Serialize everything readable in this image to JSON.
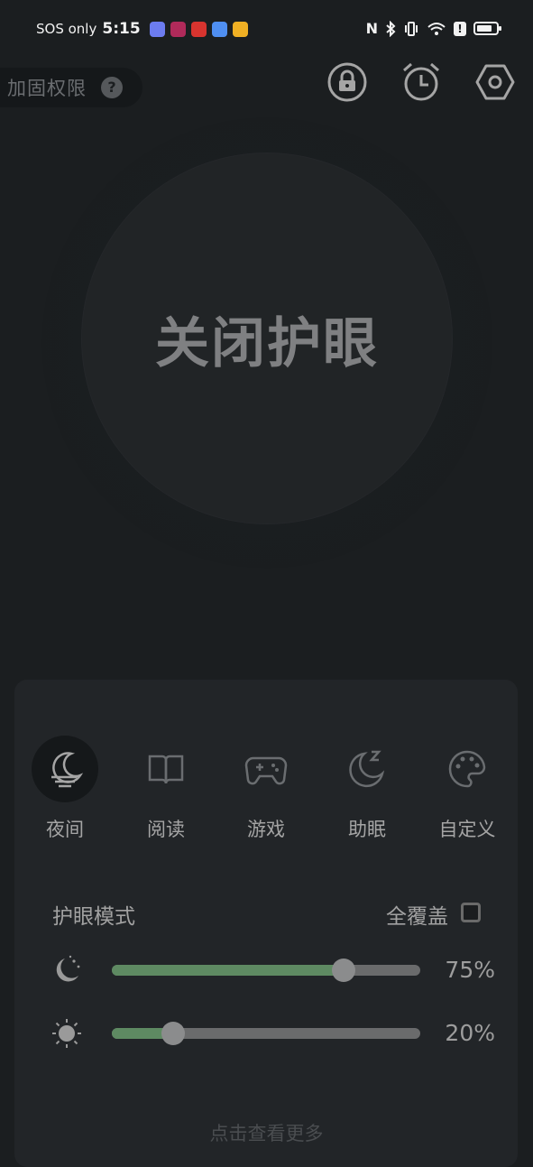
{
  "status_bar": {
    "carrier": "SOS only",
    "time": "5:15",
    "battery_level": 0.85,
    "app_colors": [
      "#6c7cf0",
      "#b02a5a",
      "#d8342f",
      "#4f8ff2",
      "#f0b024"
    ]
  },
  "top": {
    "permission_label": "加固权限",
    "help_glyph": "?",
    "icons": [
      "lock-icon",
      "alarm-clock-icon",
      "settings-hex-icon"
    ]
  },
  "main": {
    "toggle_label": "关闭护眼"
  },
  "modes": [
    {
      "label": "夜间",
      "icon": "moon-cloud-icon",
      "active": true
    },
    {
      "label": "阅读",
      "icon": "book-icon",
      "active": false
    },
    {
      "label": "游戏",
      "icon": "gamepad-icon",
      "active": false
    },
    {
      "label": "助眠",
      "icon": "sleep-moon-icon",
      "active": false
    },
    {
      "label": "自定义",
      "icon": "palette-icon",
      "active": false
    }
  ],
  "settings": {
    "eye_mode_label": "护眼模式",
    "full_cover_label": "全覆盖",
    "full_cover_checked": false
  },
  "sliders": [
    {
      "name": "filter-intensity",
      "icon": "moon-stars-icon",
      "value": 0.75,
      "label": "75%"
    },
    {
      "name": "brightness",
      "icon": "sun-icon",
      "value": 0.2,
      "label": "20%"
    }
  ],
  "footer": {
    "more_label": "点击查看更多"
  },
  "colors": {
    "background": "#1b1e20",
    "card": "#222528",
    "slider_fill": "#5e8a62",
    "track": "#6a6b6c"
  }
}
